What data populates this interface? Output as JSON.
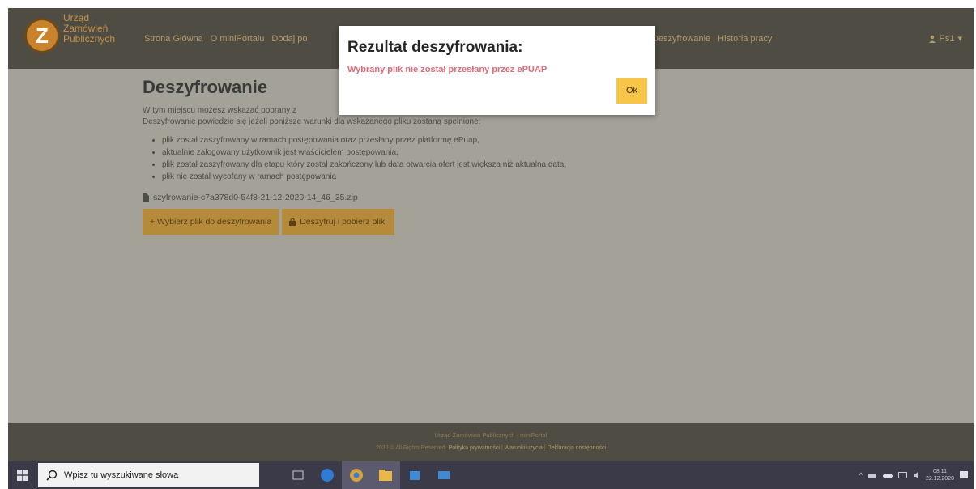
{
  "navbar": {
    "logo_lines": [
      "Urząd",
      "Zamówień",
      "Publicznych"
    ],
    "items": [
      "Strona Główna",
      "O miniPortalu",
      "Dodaj po"
    ],
    "right_items": [
      "Deszyfrowanie",
      "Historia pracy"
    ],
    "user": "Ps1"
  },
  "main": {
    "title": "Deszyfrowanie",
    "intro_line1": "W tym miejscu możesz wskazać pobrany z",
    "intro_line2": "Deszyfrowanie powiedzie się jeżeli poniższe warunki dla wskazanego pliku zostaną spełnione:",
    "conditions": [
      "plik został zaszyfrowany w ramach postępowania oraz przesłany przez platformę ePuap,",
      "aktualnie zalogowany użytkownik jest właścicielem postępowania,",
      "plik został zaszyfrowany dla etapu który został zakończony lub data otwarcia ofert jest większa niż aktualna data,",
      "plik nie został wycofany w ramach postępowania"
    ],
    "file_name": "szyfrowanie-c7a378d0-54f8-21-12-2020-14_46_35.zip",
    "select_button": "+ Wybierz plik do deszyfrowania",
    "decrypt_button": "Deszyfruj i pobierz pliki"
  },
  "modal": {
    "title": "Rezultat deszyfrowania:",
    "message": "Wybrany plik nie został przesłany przez ePUAP",
    "ok_label": "Ok"
  },
  "footer": {
    "line1": "Urząd Zamówień Publicznych - miniPortal",
    "line2_prefix": "2020 © All Rights Reserved.",
    "line2_links": [
      "Polityka prywatności",
      "Warunki użycia",
      "Deklaracja dostępności"
    ]
  },
  "taskbar": {
    "search_placeholder": "Wpisz tu wyszukiwane słowa",
    "time": "08:11",
    "date": "22.12.2020"
  },
  "colors": {
    "navbar": "#4f4c43",
    "accent": "#b58a3a",
    "ok_button": "#f7c548",
    "error_text": "#e06b79"
  }
}
